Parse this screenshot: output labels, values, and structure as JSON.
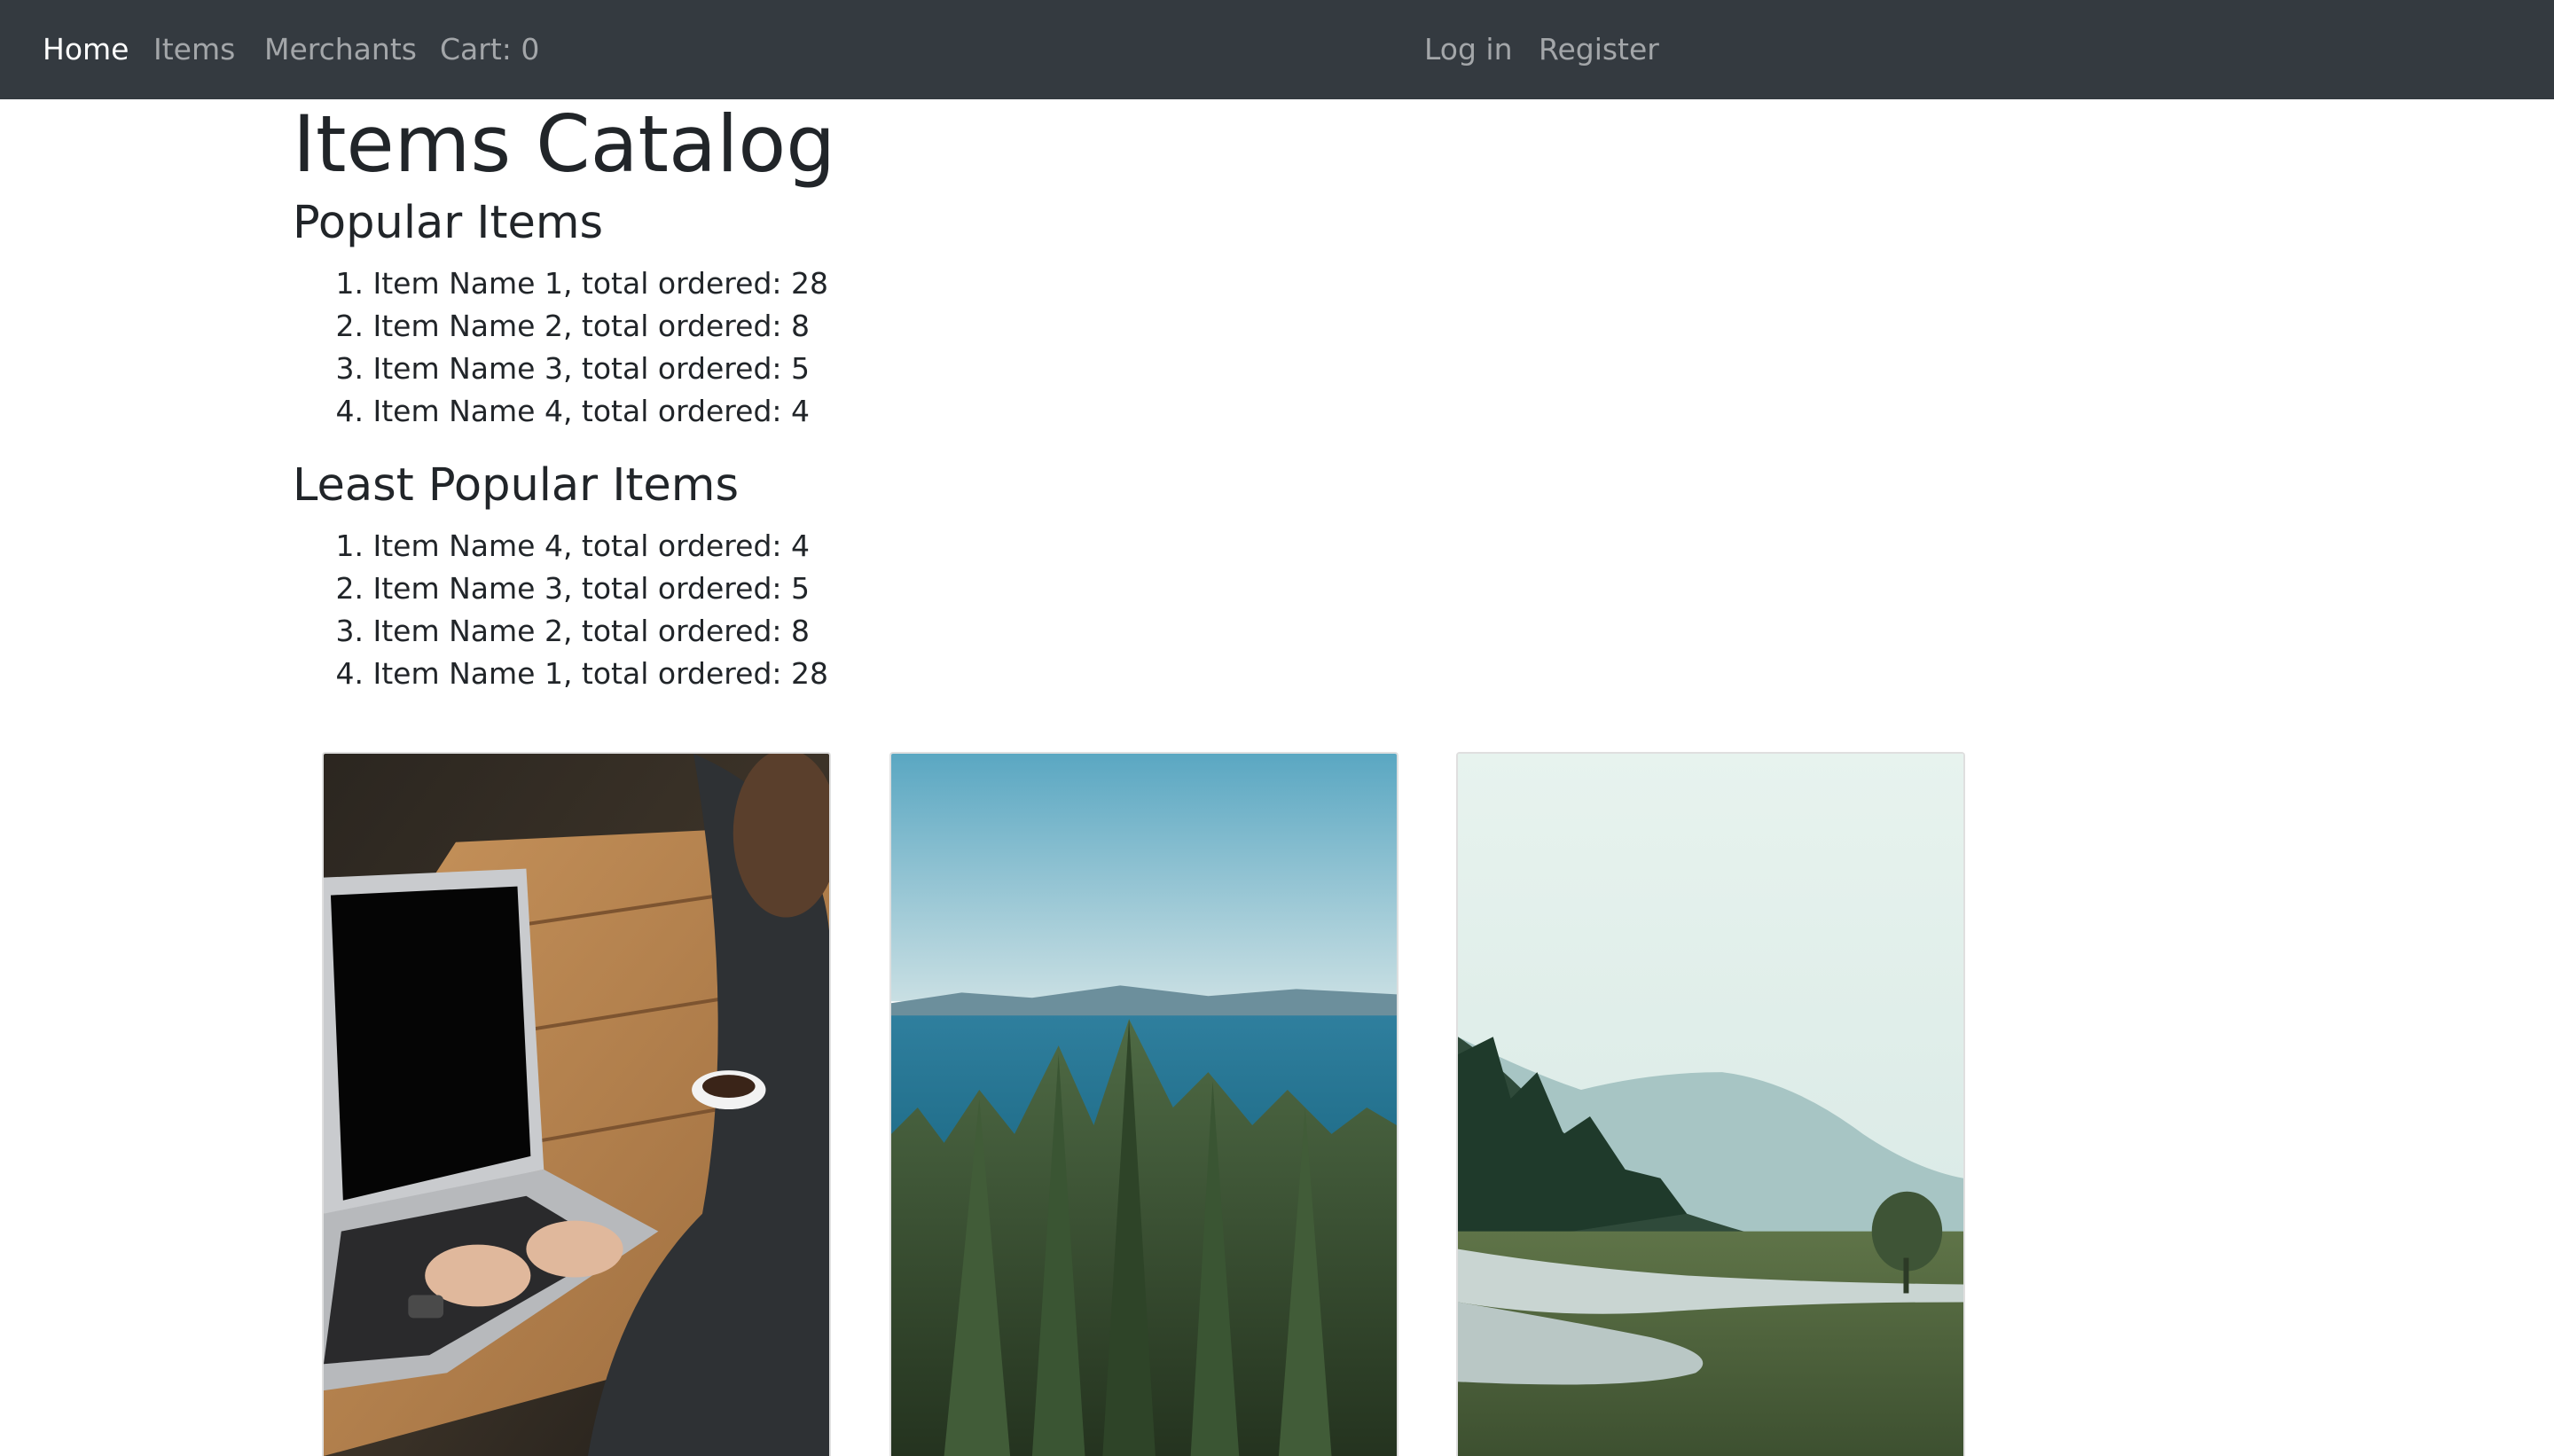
{
  "nav": {
    "home": "Home",
    "items": "Items",
    "merchants": "Merchants",
    "cart": "Cart: 0",
    "login": "Log in",
    "register": "Register"
  },
  "page": {
    "title": "Items Catalog"
  },
  "popular": {
    "heading": "Popular Items",
    "items": [
      {
        "rank": "1.",
        "text": "Item Name 1, total ordered: 28"
      },
      {
        "rank": "2.",
        "text": "Item Name 2, total ordered: 8"
      },
      {
        "rank": "3.",
        "text": "Item Name 3, total ordered: 5"
      },
      {
        "rank": "4.",
        "text": "Item Name 4, total ordered: 4"
      }
    ]
  },
  "least_popular": {
    "heading": "Least Popular Items",
    "items": [
      {
        "rank": "1.",
        "text": "Item Name 4, total ordered: 4"
      },
      {
        "rank": "2.",
        "text": "Item Name 3, total ordered: 5"
      },
      {
        "rank": "3.",
        "text": "Item Name 2, total ordered: 8"
      },
      {
        "rank": "4.",
        "text": "Item Name 1, total ordered: 28"
      }
    ]
  },
  "cards": [
    {
      "image": "laptop-photo"
    },
    {
      "image": "forest-lake-photo"
    },
    {
      "image": "misty-valley-photo"
    }
  ],
  "colors": {
    "navbar": "#343a40",
    "nav_active": "#ffffff",
    "nav_inactive": "#9a9da0",
    "text": "#212529"
  }
}
